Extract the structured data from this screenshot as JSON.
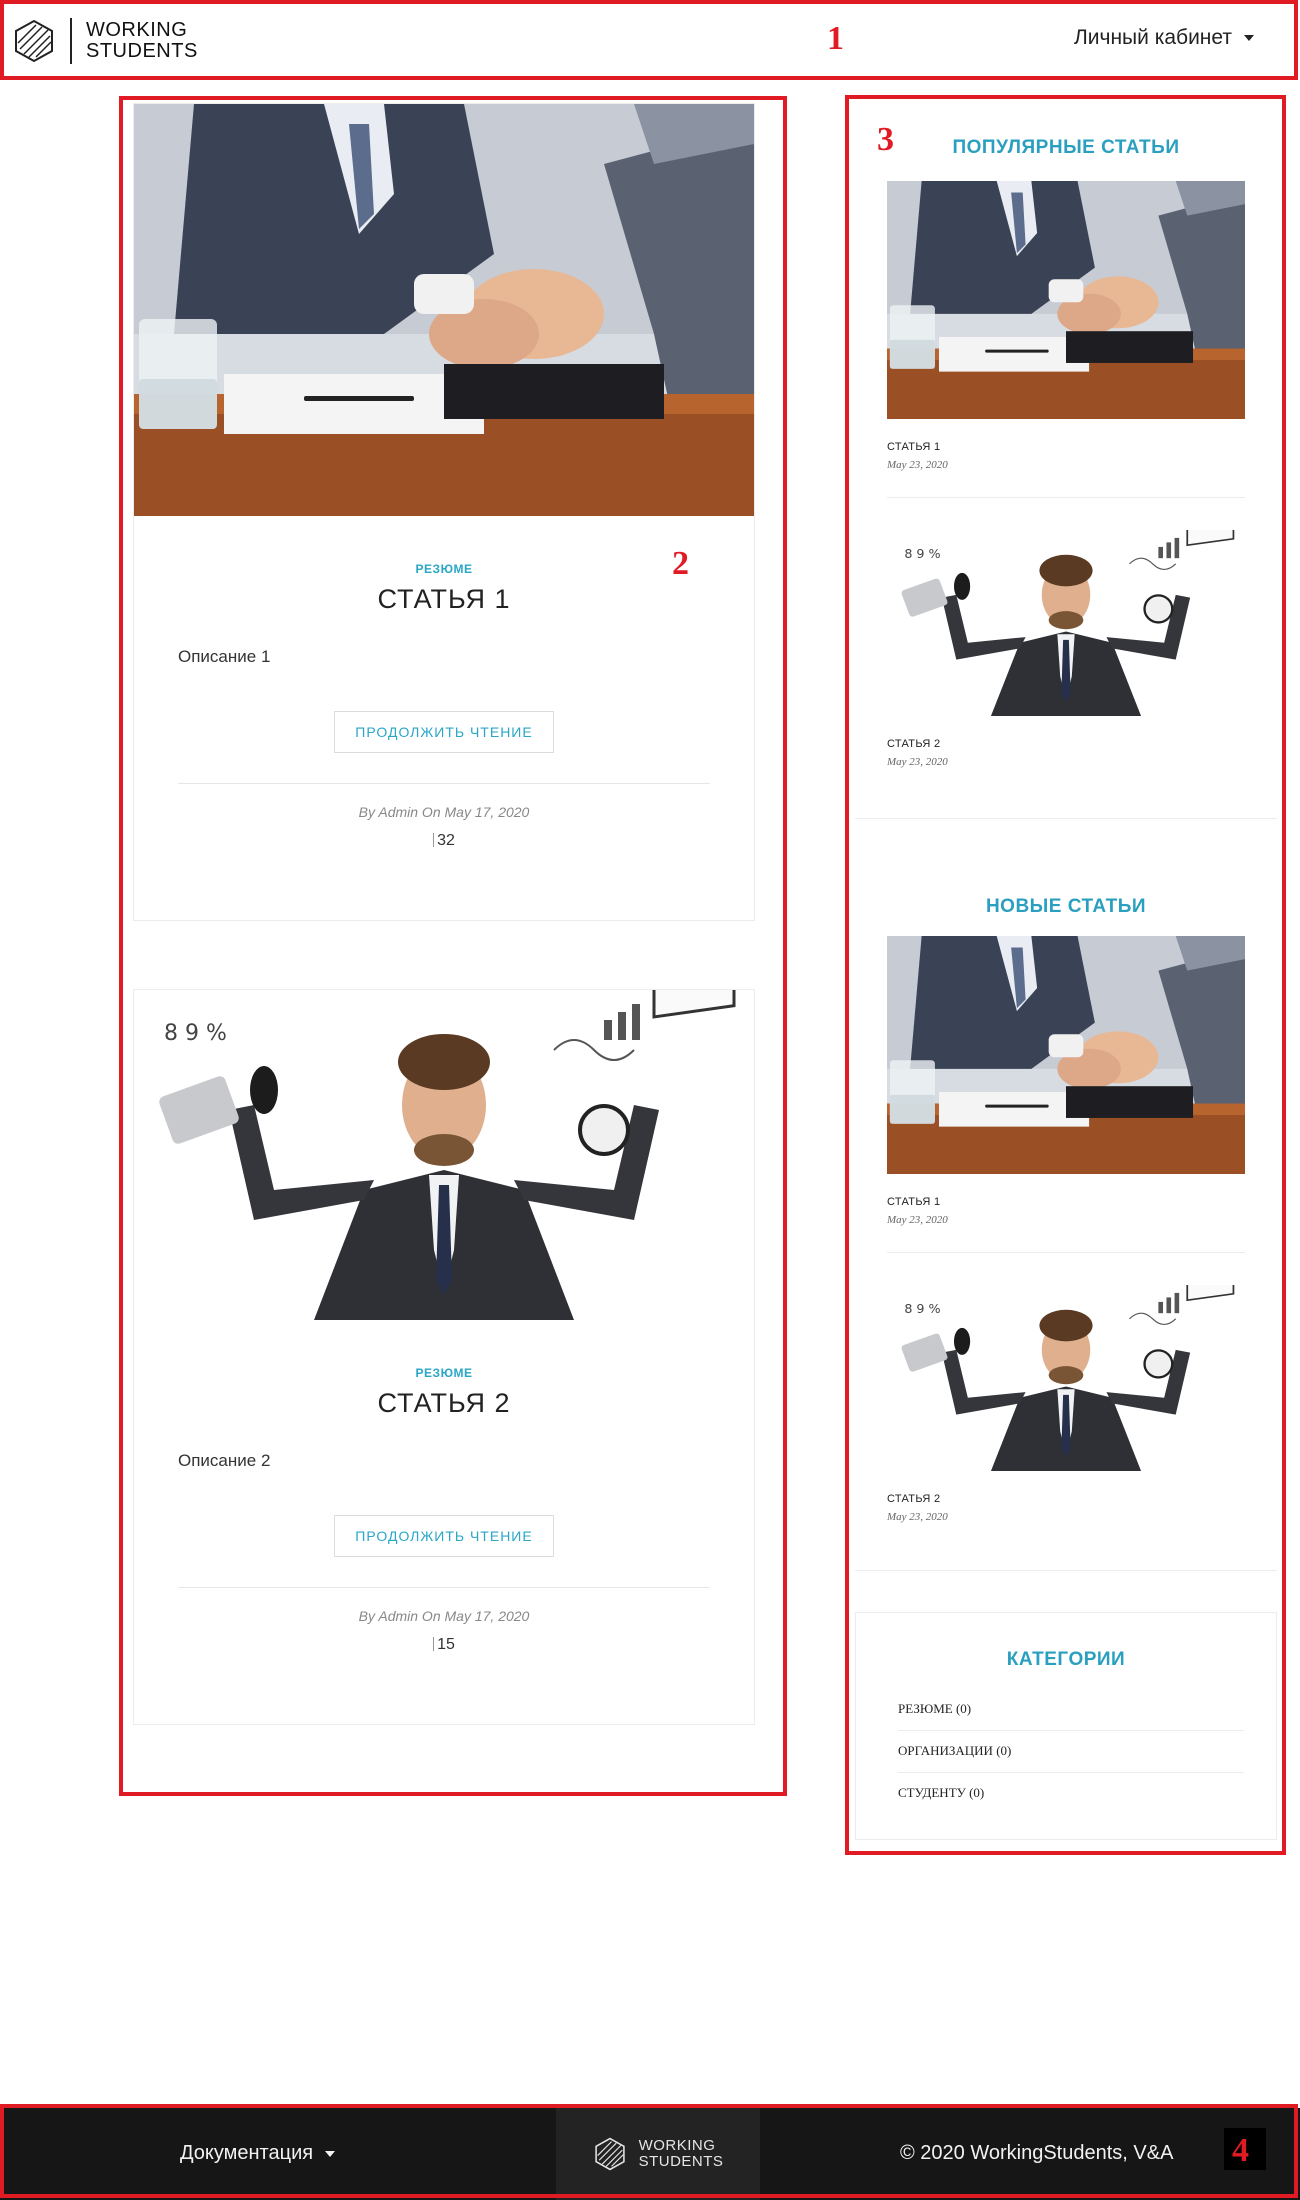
{
  "header": {
    "logo_line1": "WORKING",
    "logo_line2": "STUDENTS",
    "account_label": "Личный кабинет"
  },
  "annotations": [
    "1",
    "2",
    "3",
    "4"
  ],
  "posts": [
    {
      "category": "РЕЗЮМЕ",
      "title": "СТАТЬЯ 1",
      "description": "Описание 1",
      "read_more": "ПРОДОЛЖИТЬ ЧТЕНИЕ",
      "byline": "By Admin On May 17, 2020",
      "views": "32",
      "image": "handshake-photo"
    },
    {
      "category": "РЕЗЮМЕ",
      "title": "СТАТЬЯ 2",
      "description": "Описание 2",
      "read_more": "ПРОДОЛЖИТЬ ЧТЕНИЕ",
      "byline": "By Admin On May 17, 2020",
      "views": "15",
      "image": "multitasking-man-photo"
    }
  ],
  "sidebar": {
    "popular": {
      "heading": "ПОПУЛЯРНЫЕ СТАТЬИ",
      "items": [
        {
          "title": "СТАТЬЯ 1",
          "date": "May 23, 2020",
          "image": "handshake-photo"
        },
        {
          "title": "СТАТЬЯ 2",
          "date": "May 23, 2020",
          "image": "multitasking-man-photo"
        }
      ]
    },
    "recent": {
      "heading": "НОВЫЕ СТАТЬИ",
      "items": [
        {
          "title": "СТАТЬЯ 1",
          "date": "May 23, 2020",
          "image": "handshake-photo"
        },
        {
          "title": "СТАТЬЯ 2",
          "date": "May 23, 2020",
          "image": "multitasking-man-photo"
        }
      ]
    },
    "categories": {
      "heading": "КАТЕГОРИИ",
      "items": [
        "РЕЗЮМЕ (0)",
        "ОРГАНИЗАЦИИ (0)",
        "СТУДЕНТУ (0)"
      ]
    }
  },
  "footer": {
    "docs_label": "Документация",
    "logo_line1": "WORKING",
    "logo_line2": "STUDENTS",
    "copyright": "© 2020 WorkingStudents, V&A"
  },
  "colors": {
    "accent": "#2aa6c7",
    "annotation": "#e01b24",
    "footer_bg": "#161616"
  }
}
